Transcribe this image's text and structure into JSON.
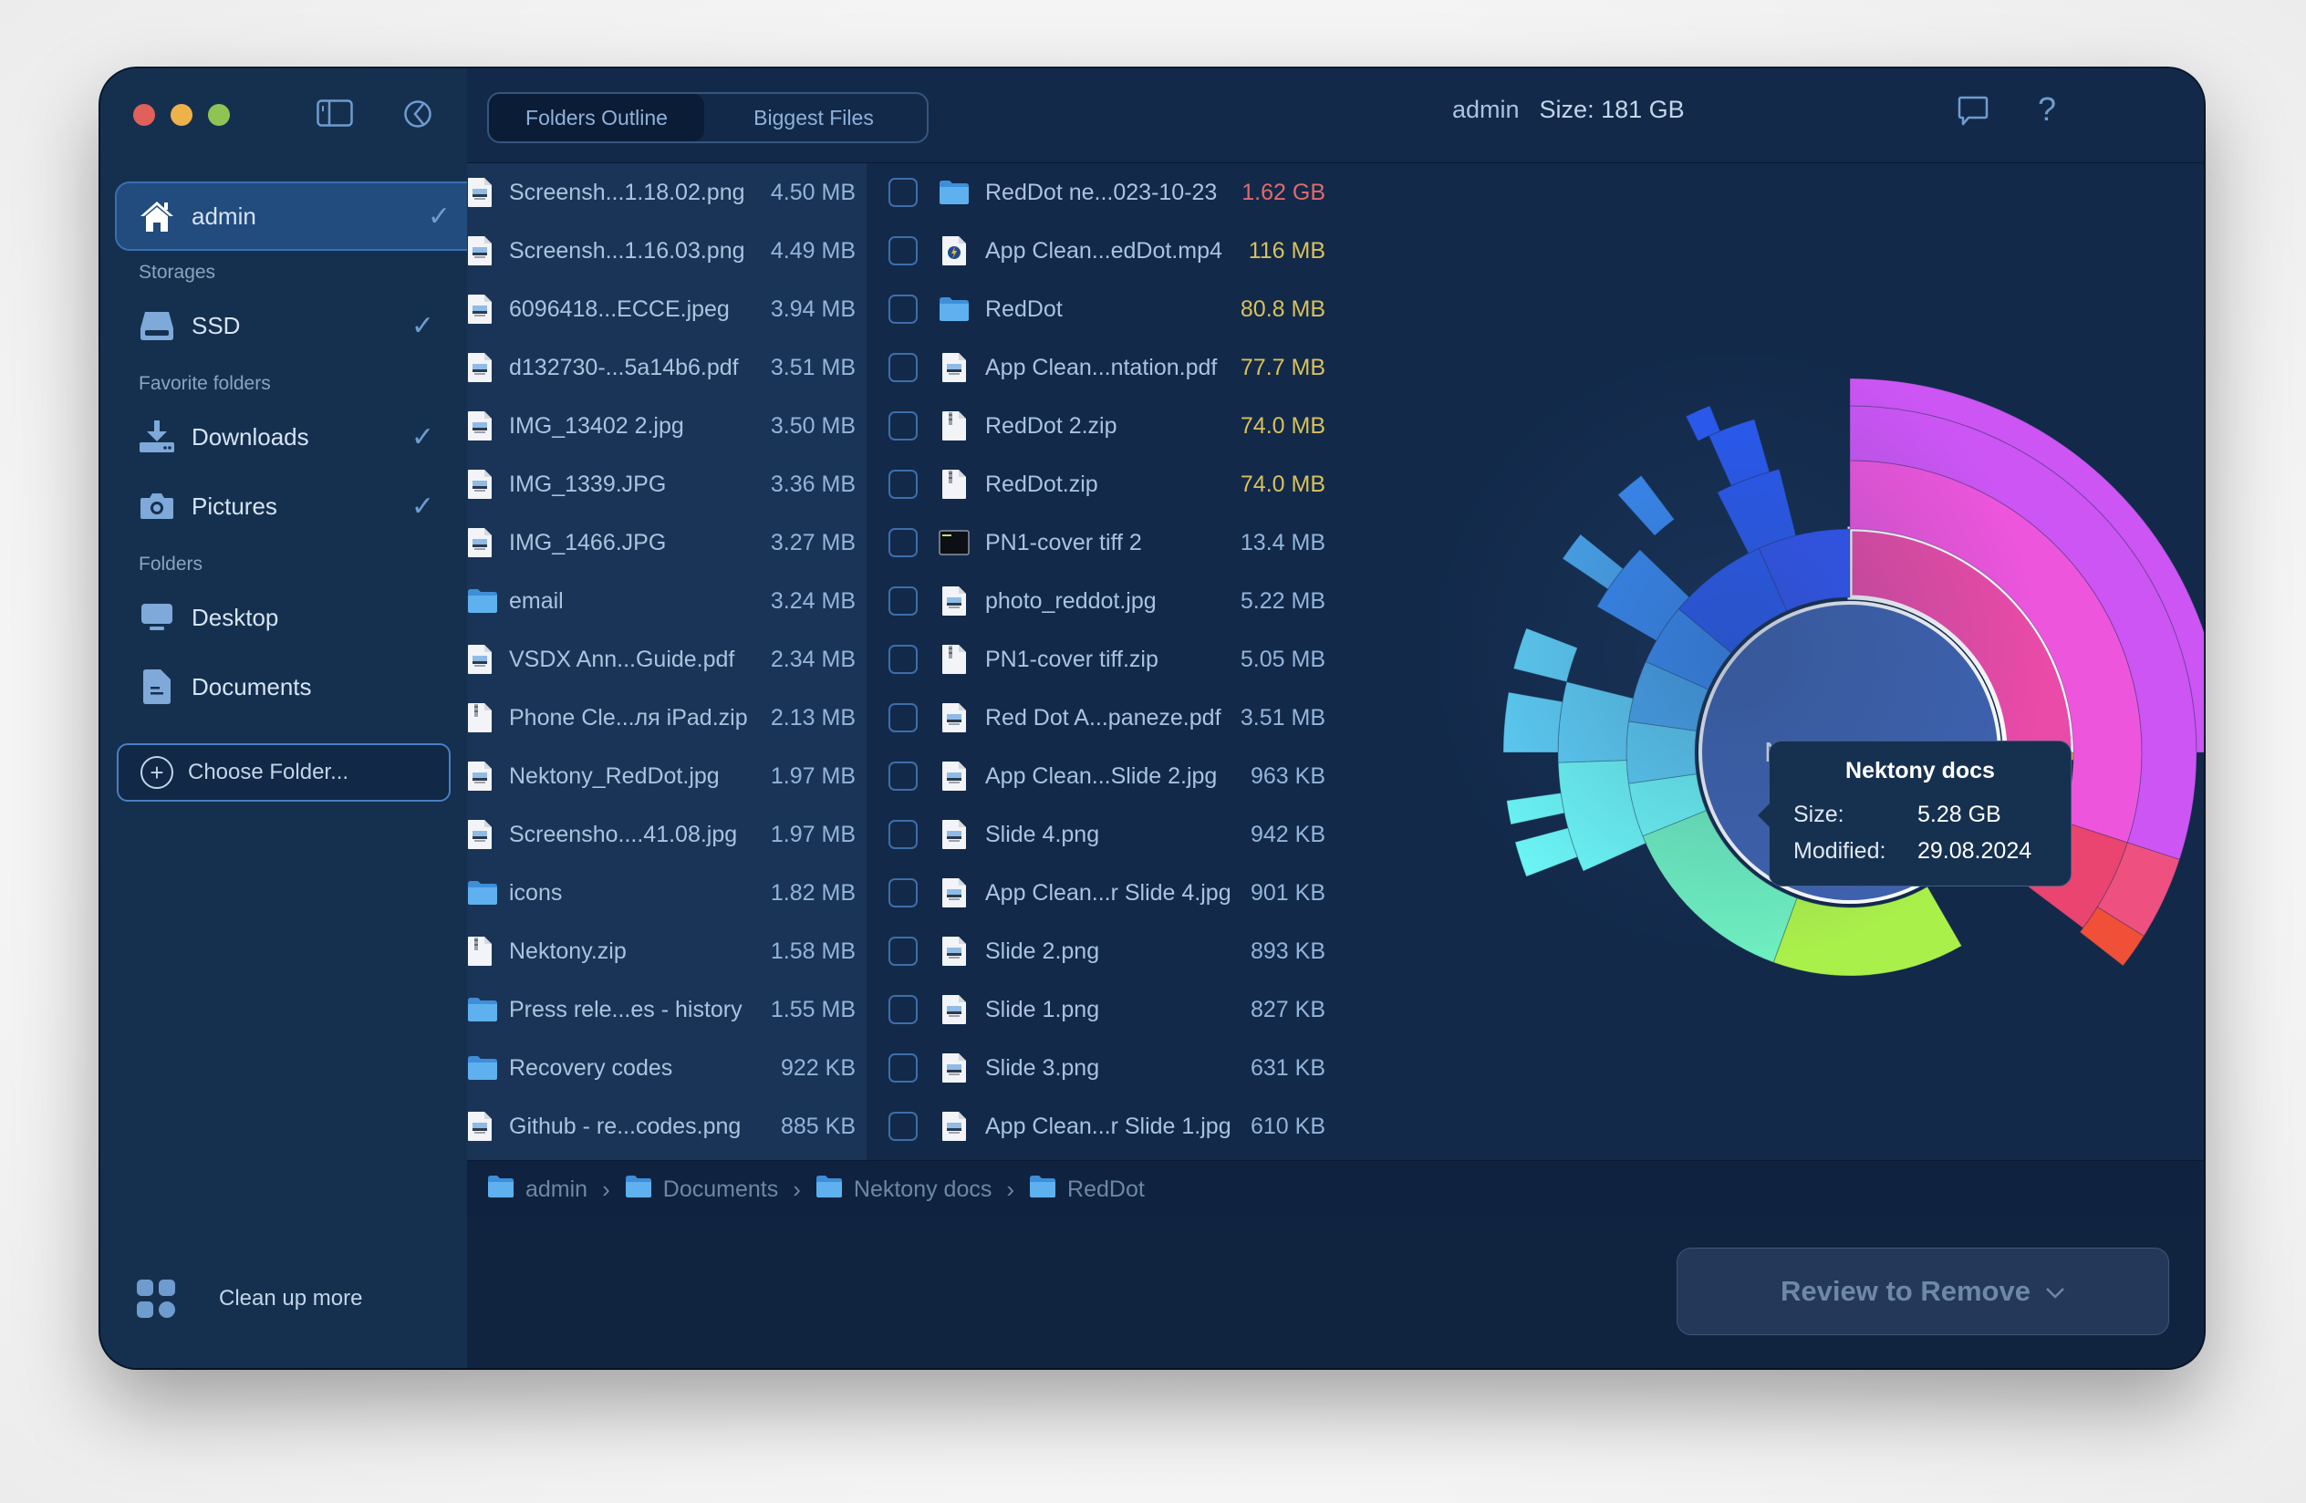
{
  "window": {
    "title_location": "admin",
    "title_size": "Size: 181 GB"
  },
  "toolbar": {
    "tabs": [
      {
        "label": "Folders Outline",
        "active": true
      },
      {
        "label": "Biggest Files",
        "active": false
      }
    ],
    "icons": [
      "sidebar-toggle-icon",
      "pie-chart-icon",
      "feedback-icon",
      "help-icon"
    ],
    "help_glyph": "?"
  },
  "sidebar": {
    "home": {
      "label": "admin",
      "checked": true,
      "icon": "home-icon"
    },
    "sections": {
      "storages": "Storages",
      "favorites": "Favorite folders",
      "folders": "Folders"
    },
    "storages": [
      {
        "label": "SSD",
        "checked": true,
        "icon": "drive-icon"
      }
    ],
    "favorites": [
      {
        "label": "Downloads",
        "checked": true,
        "icon": "download-icon"
      },
      {
        "label": "Pictures",
        "checked": true,
        "icon": "camera-icon"
      }
    ],
    "folders": [
      {
        "label": "Desktop",
        "icon": "desktop-icon"
      },
      {
        "label": "Documents",
        "icon": "document-icon"
      }
    ],
    "choose_folder": "Choose Folder...",
    "cleanup_more": "Clean up more",
    "check_glyph": "✓"
  },
  "left_list": [
    {
      "name": "Screensh...1.18.02.png",
      "size": "4.50 MB",
      "type": "image"
    },
    {
      "name": "Screensh...1.16.03.png",
      "size": "4.49 MB",
      "type": "image"
    },
    {
      "name": "6096418...ECCE.jpeg",
      "size": "3.94 MB",
      "type": "image"
    },
    {
      "name": "d132730-...5a14b6.pdf",
      "size": "3.51 MB",
      "type": "image"
    },
    {
      "name": "IMG_13402 2.jpg",
      "size": "3.50 MB",
      "type": "image"
    },
    {
      "name": "IMG_1339.JPG",
      "size": "3.36 MB",
      "type": "image"
    },
    {
      "name": "IMG_1466.JPG",
      "size": "3.27 MB",
      "type": "image"
    },
    {
      "name": "email",
      "size": "3.24 MB",
      "type": "folder"
    },
    {
      "name": "VSDX Ann...Guide.pdf",
      "size": "2.34 MB",
      "type": "image"
    },
    {
      "name": "Phone Cle...ля iPad.zip",
      "size": "2.13 MB",
      "type": "zip"
    },
    {
      "name": "Nektony_RedDot.jpg",
      "size": "1.97 MB",
      "type": "image"
    },
    {
      "name": "Screensho....41.08.jpg",
      "size": "1.97 MB",
      "type": "image"
    },
    {
      "name": "icons",
      "size": "1.82 MB",
      "type": "folder"
    },
    {
      "name": "Nektony.zip",
      "size": "1.58 MB",
      "type": "zip"
    },
    {
      "name": "Press rele...es - history",
      "size": "1.55 MB",
      "type": "folder"
    },
    {
      "name": "Recovery codes",
      "size": "922 KB",
      "type": "folder"
    },
    {
      "name": "Github - re...codes.png",
      "size": "885 KB",
      "type": "image"
    }
  ],
  "middle_list": [
    {
      "name": "RedDot ne...023-10-23",
      "size": "1.62 GB",
      "type": "folder",
      "size_color": "#e06a6a",
      "checked": false
    },
    {
      "name": "App Clean...edDot.mp4",
      "size": "116 MB",
      "type": "video",
      "size_color": "#d8c15a",
      "checked": false
    },
    {
      "name": "RedDot",
      "size": "80.8 MB",
      "type": "folder",
      "size_color": "#d8c15a",
      "checked": false
    },
    {
      "name": "App Clean...ntation.pdf",
      "size": "77.7 MB",
      "type": "image",
      "size_color": "#d8c15a",
      "checked": false
    },
    {
      "name": "RedDot 2.zip",
      "size": "74.0 MB",
      "type": "zip",
      "size_color": "#d8c15a",
      "checked": false
    },
    {
      "name": "RedDot.zip",
      "size": "74.0 MB",
      "type": "zip",
      "size_color": "#d8c15a",
      "checked": false
    },
    {
      "name": "PN1-cover tiff 2",
      "size": "13.4 MB",
      "type": "terminal",
      "size_color": "#93b4da",
      "checked": false
    },
    {
      "name": "photo_reddot.jpg",
      "size": "5.22 MB",
      "type": "image",
      "size_color": "#93b4da",
      "checked": false
    },
    {
      "name": "PN1-cover tiff.zip",
      "size": "5.05 MB",
      "type": "zip",
      "size_color": "#93b4da",
      "checked": false
    },
    {
      "name": "Red Dot A...paneze.pdf",
      "size": "3.51 MB",
      "type": "image",
      "size_color": "#93b4da",
      "checked": false
    },
    {
      "name": "App Clean...Slide 2.jpg",
      "size": "963 KB",
      "type": "image",
      "size_color": "#93b4da",
      "checked": false
    },
    {
      "name": "Slide 4.png",
      "size": "942 KB",
      "type": "image",
      "size_color": "#93b4da",
      "checked": false
    },
    {
      "name": "App Clean...r Slide 4.jpg",
      "size": "901 KB",
      "type": "image",
      "size_color": "#93b4da",
      "checked": false
    },
    {
      "name": "Slide 2.png",
      "size": "893 KB",
      "type": "image",
      "size_color": "#93b4da",
      "checked": false
    },
    {
      "name": "Slide 1.png",
      "size": "827 KB",
      "type": "image",
      "size_color": "#93b4da",
      "checked": false
    },
    {
      "name": "Slide 3.png",
      "size": "631 KB",
      "type": "image",
      "size_color": "#93b4da",
      "checked": false
    },
    {
      "name": "App Clean...r Slide 1.jpg",
      "size": "610 KB",
      "type": "image",
      "size_color": "#93b4da",
      "checked": false
    }
  ],
  "sunburst": {
    "center_label": "Nektony docs",
    "tooltip": {
      "title": "Nektony docs",
      "size_label": "Size:",
      "size_value": "5.28 GB",
      "modified_label": "Modified:",
      "modified_value": "29.08.2024"
    },
    "rings": [
      {
        "ring": 1,
        "segments": [
          {
            "start": 0,
            "end": 90,
            "color": "#ea4aa8",
            "highlighted": true
          },
          {
            "start": 90,
            "end": 92,
            "color": "#f0a050"
          },
          {
            "start": 150,
            "end": 200,
            "color": "#aaf04a"
          },
          {
            "start": 200,
            "end": 248,
            "color": "#6ef0c0"
          },
          {
            "start": 248,
            "end": 262,
            "color": "#6cf6f6"
          },
          {
            "start": 262,
            "end": 278,
            "color": "#5ecff6"
          },
          {
            "start": 278,
            "end": 294,
            "color": "#4aa8f0"
          },
          {
            "start": 294,
            "end": 310,
            "color": "#3a8cf6"
          },
          {
            "start": 310,
            "end": 336,
            "color": "#2a5af6"
          },
          {
            "start": 336,
            "end": 360,
            "color": "#3355f6"
          }
        ]
      },
      {
        "ring": 2,
        "segments": [
          {
            "start": 0,
            "end": 108,
            "color": "#ee55dd"
          },
          {
            "start": 108,
            "end": 127,
            "color": "#ea4470"
          },
          {
            "start": 246,
            "end": 268,
            "color": "#6cf6f6"
          },
          {
            "start": 268,
            "end": 284,
            "color": "#5ecff6"
          },
          {
            "start": 300,
            "end": 314,
            "color": "#3a8cf6"
          },
          {
            "start": 333,
            "end": 346,
            "color": "#2a5af6"
          }
        ]
      },
      {
        "ring": 3,
        "segments": [
          {
            "start": 0,
            "end": 108,
            "color": "#cc55f4"
          },
          {
            "start": 108,
            "end": 122,
            "color": "#ee5080"
          },
          {
            "start": 122,
            "end": 128,
            "color": "#f05038"
          },
          {
            "start": 249,
            "end": 255,
            "color": "#6cf6f6"
          },
          {
            "start": 258,
            "end": 262,
            "color": "#6cf6f6"
          },
          {
            "start": 270,
            "end": 280,
            "color": "#5ecff6"
          },
          {
            "start": 284,
            "end": 291,
            "color": "#5ecff6"
          },
          {
            "start": 304,
            "end": 309,
            "color": "#4aa8f0"
          },
          {
            "start": 318,
            "end": 323,
            "color": "#3a8cf6"
          },
          {
            "start": 336,
            "end": 344,
            "color": "#2a5af6"
          }
        ]
      },
      {
        "ring": 4,
        "segments": [
          {
            "start": 0,
            "end": 90,
            "color": "#cc55f4"
          },
          {
            "start": 334,
            "end": 338,
            "color": "#2a5af6"
          }
        ]
      }
    ]
  },
  "breadcrumb": [
    {
      "label": "admin",
      "icon": "home-folder-icon"
    },
    {
      "label": "Documents",
      "icon": "documents-folder-icon"
    },
    {
      "label": "Nektony docs",
      "icon": "folder-icon"
    },
    {
      "label": "RedDot",
      "icon": "folder-icon"
    }
  ],
  "breadcrumb_sep": "›",
  "actions": {
    "review_to_remove": "Review to Remove",
    "review_chevron": "⌄"
  }
}
